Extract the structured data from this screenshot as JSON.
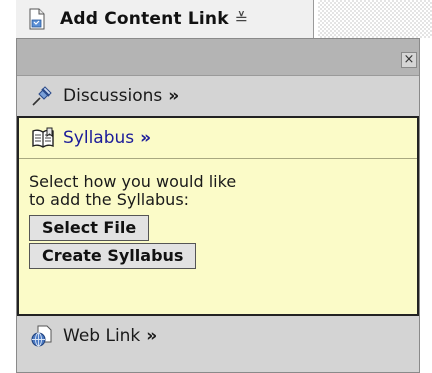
{
  "header": {
    "title": "Add Content Link",
    "title_icon": "add-content-icon",
    "toggle_icon": "collapse-toggle-icon"
  },
  "panel": {
    "close_icon": "close-icon",
    "items": [
      {
        "label": "Discussions",
        "arrow": "»",
        "icon": "pushpin-icon"
      },
      {
        "label": "Syllabus",
        "arrow": "»",
        "icon": "book-icon"
      },
      {
        "label": "Web Link",
        "arrow": "»",
        "icon": "globe-document-icon"
      }
    ],
    "syllabus": {
      "prompt_line1": "Select how you would like",
      "prompt_line2": "to add the Syllabus:",
      "select_file_label": "Select File",
      "create_syllabus_label": "Create Syllabus"
    }
  },
  "colors": {
    "panel_bg": "#d4d4d4",
    "topbar_bg": "#b4b4b4",
    "highlight_bg": "#fbfbc8",
    "link_blue": "#1c1c9a"
  }
}
